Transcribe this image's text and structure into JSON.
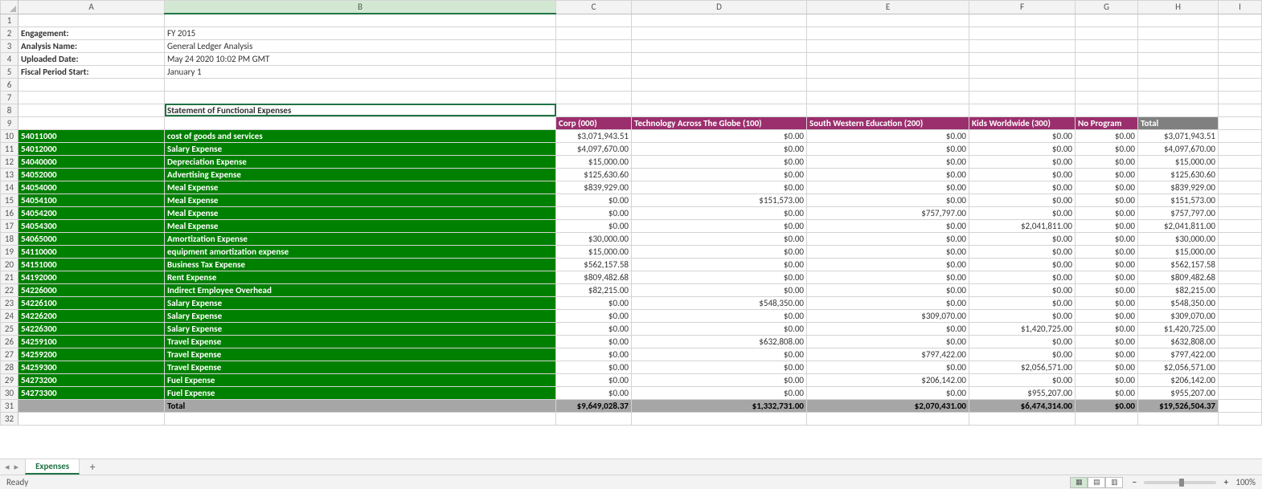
{
  "columns": [
    "A",
    "B",
    "C",
    "D",
    "E",
    "F",
    "G",
    "H",
    "I"
  ],
  "meta": {
    "engagement_label": "Engagement:",
    "engagement_value": "FY 2015",
    "analysis_label": "Analysis Name:",
    "analysis_value": "General Ledger Analysis",
    "uploaded_label": "Uploaded Date:",
    "uploaded_value": "May 24 2020 10:02 PM GMT",
    "fiscal_label": "Fiscal Period Start:",
    "fiscal_value": "January 1",
    "title": "Statement of Functional Expenses"
  },
  "headers": {
    "c": "Corp (000)",
    "d": "Technology Across The Globe (100)",
    "e": "South Western Education (200)",
    "f": "Kids Worldwide (300)",
    "g": "No Program",
    "h": "Total"
  },
  "rows": [
    {
      "code": "54011000",
      "name": "cost of goods and services",
      "c": "$3,071,943.51",
      "d": "$0.00",
      "e": "$0.00",
      "f": "$0.00",
      "g": "$0.00",
      "h": "$3,071,943.51"
    },
    {
      "code": "54012000",
      "name": "Salary Expense",
      "c": "$4,097,670.00",
      "d": "$0.00",
      "e": "$0.00",
      "f": "$0.00",
      "g": "$0.00",
      "h": "$4,097,670.00"
    },
    {
      "code": "54040000",
      "name": "Depreciation Expense",
      "c": "$15,000.00",
      "d": "$0.00",
      "e": "$0.00",
      "f": "$0.00",
      "g": "$0.00",
      "h": "$15,000.00"
    },
    {
      "code": "54052000",
      "name": "Advertising Expense",
      "c": "$125,630.60",
      "d": "$0.00",
      "e": "$0.00",
      "f": "$0.00",
      "g": "$0.00",
      "h": "$125,630.60"
    },
    {
      "code": "54054000",
      "name": "Meal Expense",
      "c": "$839,929.00",
      "d": "$0.00",
      "e": "$0.00",
      "f": "$0.00",
      "g": "$0.00",
      "h": "$839,929.00"
    },
    {
      "code": "54054100",
      "name": "Meal Expense",
      "c": "$0.00",
      "d": "$151,573.00",
      "e": "$0.00",
      "f": "$0.00",
      "g": "$0.00",
      "h": "$151,573.00"
    },
    {
      "code": "54054200",
      "name": "Meal Expense",
      "c": "$0.00",
      "d": "$0.00",
      "e": "$757,797.00",
      "f": "$0.00",
      "g": "$0.00",
      "h": "$757,797.00"
    },
    {
      "code": "54054300",
      "name": "Meal Expense",
      "c": "$0.00",
      "d": "$0.00",
      "e": "$0.00",
      "f": "$2,041,811.00",
      "g": "$0.00",
      "h": "$2,041,811.00"
    },
    {
      "code": "54065000",
      "name": "Amortization Expense",
      "c": "$30,000.00",
      "d": "$0.00",
      "e": "$0.00",
      "f": "$0.00",
      "g": "$0.00",
      "h": "$30,000.00"
    },
    {
      "code": "54110000",
      "name": "equipment amortization  expense",
      "c": "$15,000.00",
      "d": "$0.00",
      "e": "$0.00",
      "f": "$0.00",
      "g": "$0.00",
      "h": "$15,000.00"
    },
    {
      "code": "54151000",
      "name": "Business Tax Expense",
      "c": "$562,157.58",
      "d": "$0.00",
      "e": "$0.00",
      "f": "$0.00",
      "g": "$0.00",
      "h": "$562,157.58"
    },
    {
      "code": "54192000",
      "name": "Rent Expense",
      "c": "$809,482.68",
      "d": "$0.00",
      "e": "$0.00",
      "f": "$0.00",
      "g": "$0.00",
      "h": "$809,482.68"
    },
    {
      "code": "54226000",
      "name": "Indirect Employee Overhead",
      "c": "$82,215.00",
      "d": "$0.00",
      "e": "$0.00",
      "f": "$0.00",
      "g": "$0.00",
      "h": "$82,215.00"
    },
    {
      "code": "54226100",
      "name": "Salary Expense",
      "c": "$0.00",
      "d": "$548,350.00",
      "e": "$0.00",
      "f": "$0.00",
      "g": "$0.00",
      "h": "$548,350.00"
    },
    {
      "code": "54226200",
      "name": "Salary Expense",
      "c": "$0.00",
      "d": "$0.00",
      "e": "$309,070.00",
      "f": "$0.00",
      "g": "$0.00",
      "h": "$309,070.00"
    },
    {
      "code": "54226300",
      "name": "Salary Expense",
      "c": "$0.00",
      "d": "$0.00",
      "e": "$0.00",
      "f": "$1,420,725.00",
      "g": "$0.00",
      "h": "$1,420,725.00"
    },
    {
      "code": "54259100",
      "name": "Travel Expense",
      "c": "$0.00",
      "d": "$632,808.00",
      "e": "$0.00",
      "f": "$0.00",
      "g": "$0.00",
      "h": "$632,808.00"
    },
    {
      "code": "54259200",
      "name": "Travel Expense",
      "c": "$0.00",
      "d": "$0.00",
      "e": "$797,422.00",
      "f": "$0.00",
      "g": "$0.00",
      "h": "$797,422.00"
    },
    {
      "code": "54259300",
      "name": "Travel Expense",
      "c": "$0.00",
      "d": "$0.00",
      "e": "$0.00",
      "f": "$2,056,571.00",
      "g": "$0.00",
      "h": "$2,056,571.00"
    },
    {
      "code": "54273200",
      "name": "Fuel Expense",
      "c": "$0.00",
      "d": "$0.00",
      "e": "$206,142.00",
      "f": "$0.00",
      "g": "$0.00",
      "h": "$206,142.00"
    },
    {
      "code": "54273300",
      "name": "Fuel Expense",
      "c": "$0.00",
      "d": "$0.00",
      "e": "$0.00",
      "f": "$955,207.00",
      "g": "$0.00",
      "h": "$955,207.00"
    }
  ],
  "total": {
    "label": "Total",
    "c": "$9,649,028.37",
    "d": "$1,332,731.00",
    "e": "$2,070,431.00",
    "f": "$6,474,314.00",
    "g": "$0.00",
    "h": "$19,526,504.37"
  },
  "tabs": {
    "active": "Expenses",
    "add": "+"
  },
  "status": {
    "ready": "Ready",
    "zoom": "100%",
    "minus": "−",
    "plus": "+"
  },
  "nav": {
    "first": "◂",
    "prev": "◂",
    "next": "▸",
    "last": "▸"
  },
  "icons": {
    "normal": "▦",
    "layout": "▤",
    "break": "▥"
  }
}
